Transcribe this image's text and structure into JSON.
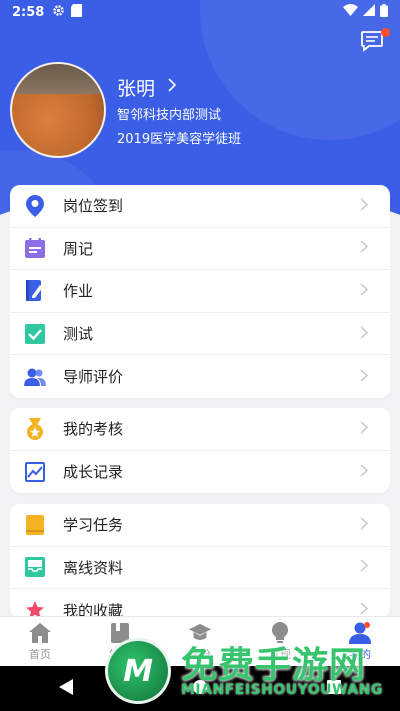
{
  "status_bar": {
    "time": "2:58"
  },
  "profile": {
    "name": "张明",
    "organization": "智邻科技内部测试",
    "class_name": "2019医学美容学徒班"
  },
  "menu_groups": [
    {
      "items": [
        {
          "label": "岗位签到",
          "icon": "location-pin-icon",
          "color": "#3a5ee6"
        },
        {
          "label": "周记",
          "icon": "calendar-note-icon",
          "color": "#8e6ee8"
        },
        {
          "label": "作业",
          "icon": "notebook-pen-icon",
          "color": "#3a5ee6"
        },
        {
          "label": "测试",
          "icon": "checkbox-icon",
          "color": "#2ec9a0"
        },
        {
          "label": "导师评价",
          "icon": "users-icon",
          "color": "#3a5ee6"
        }
      ]
    },
    {
      "items": [
        {
          "label": "我的考核",
          "icon": "medal-icon",
          "color": "#f5b323"
        },
        {
          "label": "成长记录",
          "icon": "trend-chart-icon",
          "color": "#3a5ee6"
        }
      ]
    },
    {
      "items": [
        {
          "label": "学习任务",
          "icon": "book-icon",
          "color": "#f5b323"
        },
        {
          "label": "离线资料",
          "icon": "inbox-icon",
          "color": "#2ec9a0"
        },
        {
          "label": "我的收藏",
          "icon": "star-icon",
          "color": "#f04a6a"
        }
      ]
    }
  ],
  "bottom_nav": [
    {
      "label": "首页",
      "icon": "home-icon"
    },
    {
      "label": "学习",
      "icon": "book-icon"
    },
    {
      "label": "学分",
      "icon": "graduation-cap-icon"
    },
    {
      "label": "发现",
      "icon": "lightbulb-icon"
    },
    {
      "label": "我的",
      "icon": "person-icon"
    }
  ],
  "watermark": {
    "title": "免费手游网",
    "subtitle": "MIANFEISHOUYOUWANG",
    "logo_letter": "M"
  },
  "colors": {
    "primary": "#3a5ee6",
    "badge": "#ff4d2e"
  }
}
